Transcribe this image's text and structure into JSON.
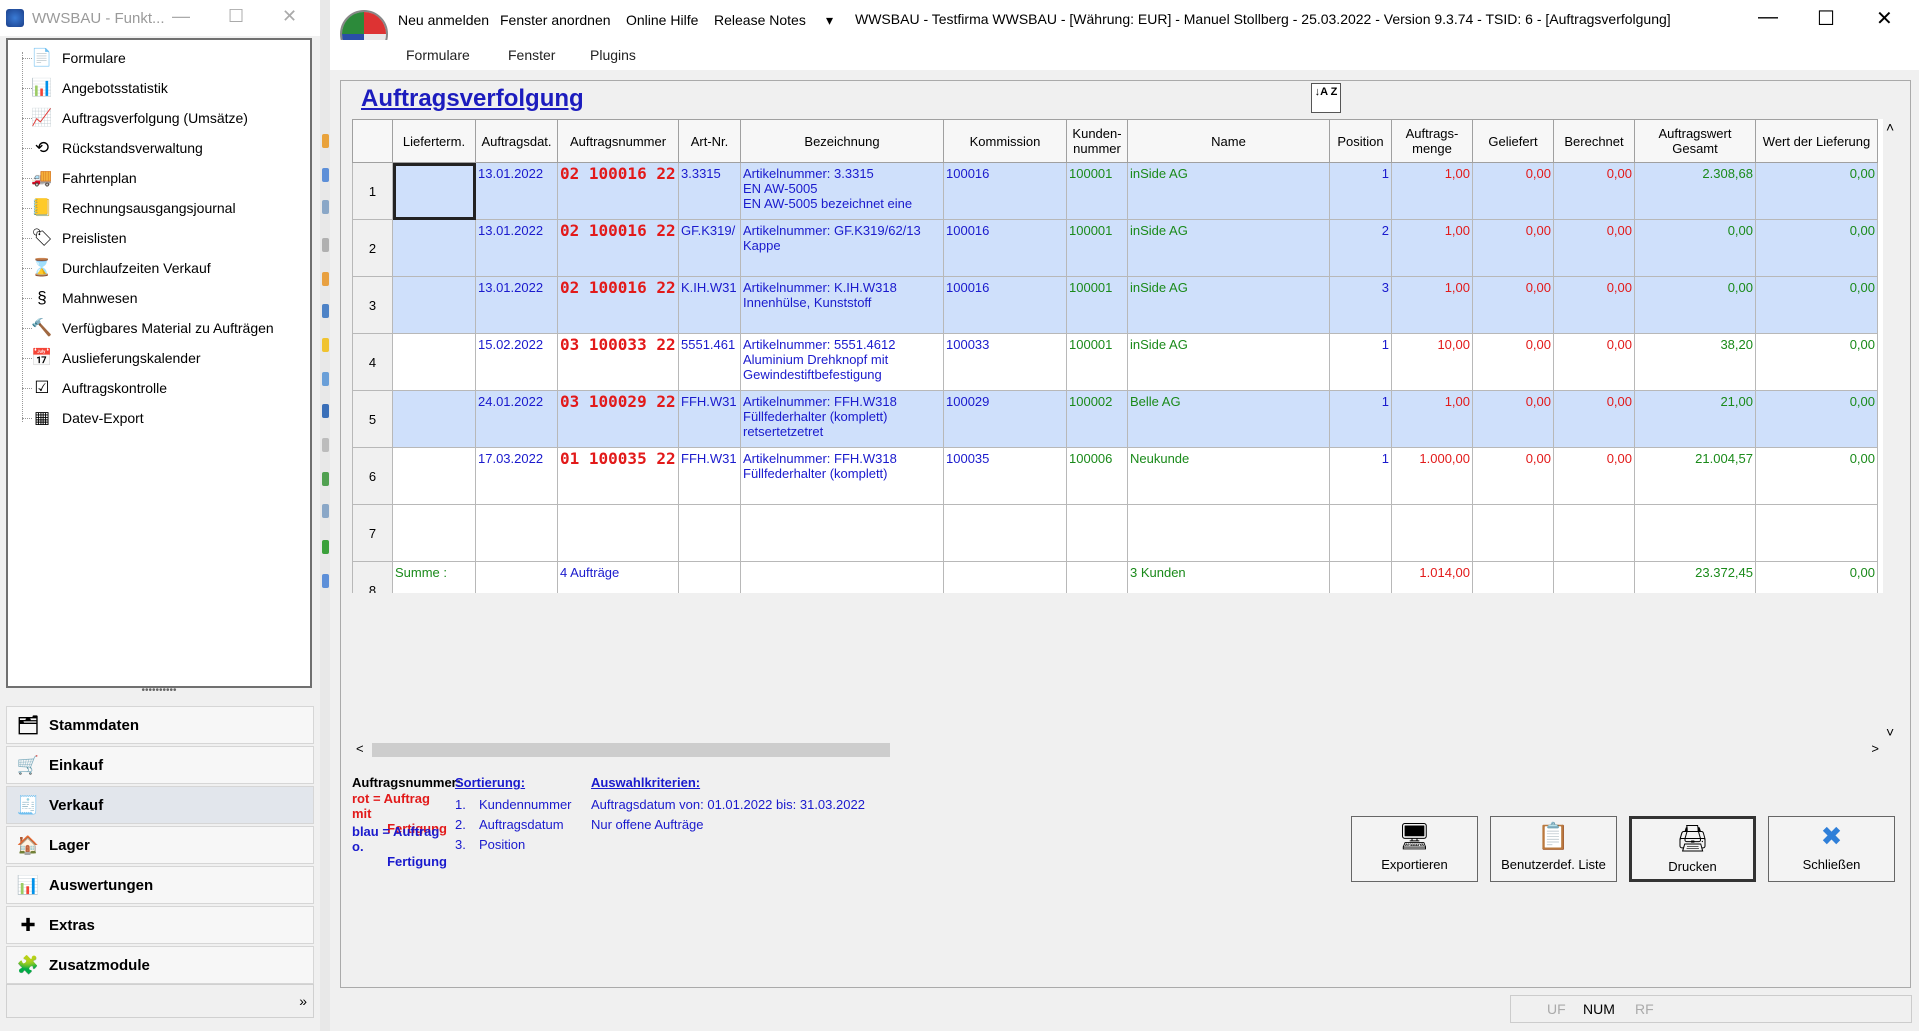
{
  "left_window": {
    "title": "WWSBAU - Funkt...",
    "controls": {
      "minimize": "—",
      "maximize": "☐",
      "close": "✕"
    },
    "tree_items": [
      {
        "label": "Formulare",
        "icon": "document-icon"
      },
      {
        "label": "Angebotsstatistik",
        "icon": "calendar-stats-icon"
      },
      {
        "label": "Auftragsverfolgung (Umsätze)",
        "icon": "tracking-icon"
      },
      {
        "label": "Rückstandsverwaltung",
        "icon": "clock-back-icon"
      },
      {
        "label": "Fahrtenplan",
        "icon": "truck-icon"
      },
      {
        "label": "Rechnungsausgangsjournal",
        "icon": "journal-icon"
      },
      {
        "label": "Preislisten",
        "icon": "tag-icon"
      },
      {
        "label": "Durchlaufzeiten Verkauf",
        "icon": "hourglass-icon"
      },
      {
        "label": "Mahnwesen",
        "icon": "dunning-icon"
      },
      {
        "label": "Verfügbares Material zu Aufträgen",
        "icon": "hammer-icon"
      },
      {
        "label": "Auslieferungskalender",
        "icon": "calendar-icon"
      },
      {
        "label": "Auftragskontrolle",
        "icon": "checklist-icon"
      },
      {
        "label": "Datev-Export",
        "icon": "datev-icon"
      }
    ],
    "splitter_dots": "••••••••••",
    "nav": [
      {
        "label": "Stammdaten",
        "icon": "master-data-icon",
        "selected": false
      },
      {
        "label": "Einkauf",
        "icon": "cart-icon",
        "selected": false
      },
      {
        "label": "Verkauf",
        "icon": "sales-icon",
        "selected": true
      },
      {
        "label": "Lager",
        "icon": "warehouse-icon",
        "selected": false
      },
      {
        "label": "Auswertungen",
        "icon": "reports-icon",
        "selected": false
      },
      {
        "label": "Extras",
        "icon": "extras-icon",
        "selected": false
      },
      {
        "label": "Zusatzmodule",
        "icon": "modules-icon",
        "selected": false
      }
    ],
    "expand_glyph": "»"
  },
  "main_window": {
    "menu_top": [
      "Neu anmelden",
      "Fenster anordnen",
      "Online Hilfe",
      "Release Notes"
    ],
    "menu_dropdown": "▾",
    "title": "WWSBAU - Testfirma WWSBAU - [Währung: EUR] - Manuel Stollberg - 25.03.2022 - Version 9.3.74 - TSID: 6  - [Auftragsverfolgung]",
    "controls": {
      "minimize": "—",
      "maximize": "☐",
      "close": "✕"
    },
    "menu_second": [
      "Formulare",
      "Fenster",
      "Plugins"
    ]
  },
  "page": {
    "heading": "Auftragsverfolgung",
    "sort_button": "↓A Z"
  },
  "table": {
    "columns": [
      "Lieferterm.",
      "Auftragsdat.",
      "Auftragsnummer",
      "Art-Nr.",
      "Bezeichnung",
      "Kommission",
      "Kunden-\nnummer",
      "Name",
      "Position",
      "Auftrags-\nmenge",
      "Geliefert",
      "Berechnet",
      "Auftragswert\nGesamt",
      "Wert der Lieferung"
    ],
    "rows": [
      {
        "n": "1",
        "lieferterm": "",
        "datum": "13.01.2022",
        "nr": "02 100016 22",
        "art": "3.3315",
        "bez": [
          "Artikelnummer: 3.3315",
          "EN AW-5005",
          "EN AW-5005 bezeichnet eine"
        ],
        "komm": "100016",
        "kunde": "100001",
        "name": "inSide AG",
        "pos": "1",
        "menge": "1,00",
        "geliefert": "0,00",
        "berechnet": "0,00",
        "gesamt": "2.308,68",
        "lieferung": "0,00",
        "hl": true
      },
      {
        "n": "2",
        "lieferterm": "",
        "datum": "13.01.2022",
        "nr": "02 100016 22",
        "art": "GF.K319/",
        "bez": [
          "Artikelnummer: GF.K319/62/13",
          "Kappe"
        ],
        "komm": "100016",
        "kunde": "100001",
        "name": "inSide AG",
        "pos": "2",
        "menge": "1,00",
        "geliefert": "0,00",
        "berechnet": "0,00",
        "gesamt": "0,00",
        "lieferung": "0,00",
        "hl": true
      },
      {
        "n": "3",
        "lieferterm": "",
        "datum": "13.01.2022",
        "nr": "02 100016 22",
        "art": "K.IH.W31",
        "bez": [
          "Artikelnummer: K.IH.W318",
          "Innenhülse, Kunststoff"
        ],
        "komm": "100016",
        "kunde": "100001",
        "name": "inSide AG",
        "pos": "3",
        "menge": "1,00",
        "geliefert": "0,00",
        "berechnet": "0,00",
        "gesamt": "0,00",
        "lieferung": "0,00",
        "hl": true
      },
      {
        "n": "4",
        "lieferterm": "",
        "datum": "15.02.2022",
        "nr": "03 100033 22",
        "art": "5551.461",
        "bez": [
          "Artikelnummer: 5551.4612",
          "Aluminium Drehknopf mit",
          "Gewindestiftbefestigung"
        ],
        "komm": "100033",
        "kunde": "100001",
        "name": "inSide AG",
        "pos": "1",
        "menge": "10,00",
        "geliefert": "0,00",
        "berechnet": "0,00",
        "gesamt": "38,20",
        "lieferung": "0,00",
        "hl": false
      },
      {
        "n": "5",
        "lieferterm": "",
        "datum": "24.01.2022",
        "nr": "03 100029 22",
        "art": "FFH.W31",
        "bez": [
          "Artikelnummer: FFH.W318",
          "Füllfederhalter (komplett)",
          "retsertetzetret"
        ],
        "komm": "100029",
        "kunde": "100002",
        "name": "Belle AG",
        "pos": "1",
        "menge": "1,00",
        "geliefert": "0,00",
        "berechnet": "0,00",
        "gesamt": "21,00",
        "lieferung": "0,00",
        "hl": true
      },
      {
        "n": "6",
        "lieferterm": "",
        "datum": "17.03.2022",
        "nr": "01 100035 22",
        "art": "FFH.W31",
        "bez": [
          "Artikelnummer: FFH.W318",
          "Füllfederhalter (komplett)"
        ],
        "komm": "100035",
        "kunde": "100006",
        "name": "Neukunde",
        "pos": "1",
        "menge": "1.000,00",
        "geliefert": "0,00",
        "berechnet": "0,00",
        "gesamt": "21.004,57",
        "lieferung": "0,00",
        "hl": false
      }
    ],
    "empty_row_n": "7",
    "summary": {
      "n": "8",
      "label": "Summe :",
      "auftraege": "4 Aufträge",
      "kunden": "3 Kunden",
      "menge": "1.014,00",
      "gesamt": "23.372,45",
      "lieferung": "0,00"
    }
  },
  "scroll": {
    "up": "˄",
    "down": "˅",
    "left": "<",
    "right": ">"
  },
  "legend": {
    "title": "Auftragsnummer:",
    "rot": [
      "rot = Auftrag mit",
      "Fertigung"
    ],
    "blau": [
      "blau = Auftrag o.",
      "Fertigung"
    ],
    "sort_title": "Sortierung:",
    "sort_nums": [
      "1.",
      "2.",
      "3."
    ],
    "sort_items": [
      "Kundennummer",
      "Auftragsdatum",
      "Position"
    ],
    "criteria_title": "Auswahlkriterien:",
    "criteria": [
      "Auftragsdatum von: 01.01.2022 bis: 31.03.2022",
      "Nur offene Aufträge"
    ]
  },
  "buttons": [
    {
      "label": "Exportieren",
      "icon": "export-icon",
      "glyph": "🖥",
      "active": false
    },
    {
      "label": "Benutzerdef. Liste",
      "icon": "custom-list-icon",
      "glyph": "📋",
      "active": false
    },
    {
      "label": "Drucken",
      "icon": "printer-icon",
      "glyph": "🖨",
      "active": true
    },
    {
      "label": "Schließen",
      "icon": "close-x-icon",
      "glyph": "✖",
      "active": false
    }
  ],
  "status": {
    "uf": "UF",
    "num": "NUM",
    "rf": "RF"
  },
  "colors": {
    "highlight_row": "#cfe0fb",
    "order_red": "#e21a1a",
    "text_blue": "#1a1acd",
    "text_green": "#1a8a1a"
  }
}
